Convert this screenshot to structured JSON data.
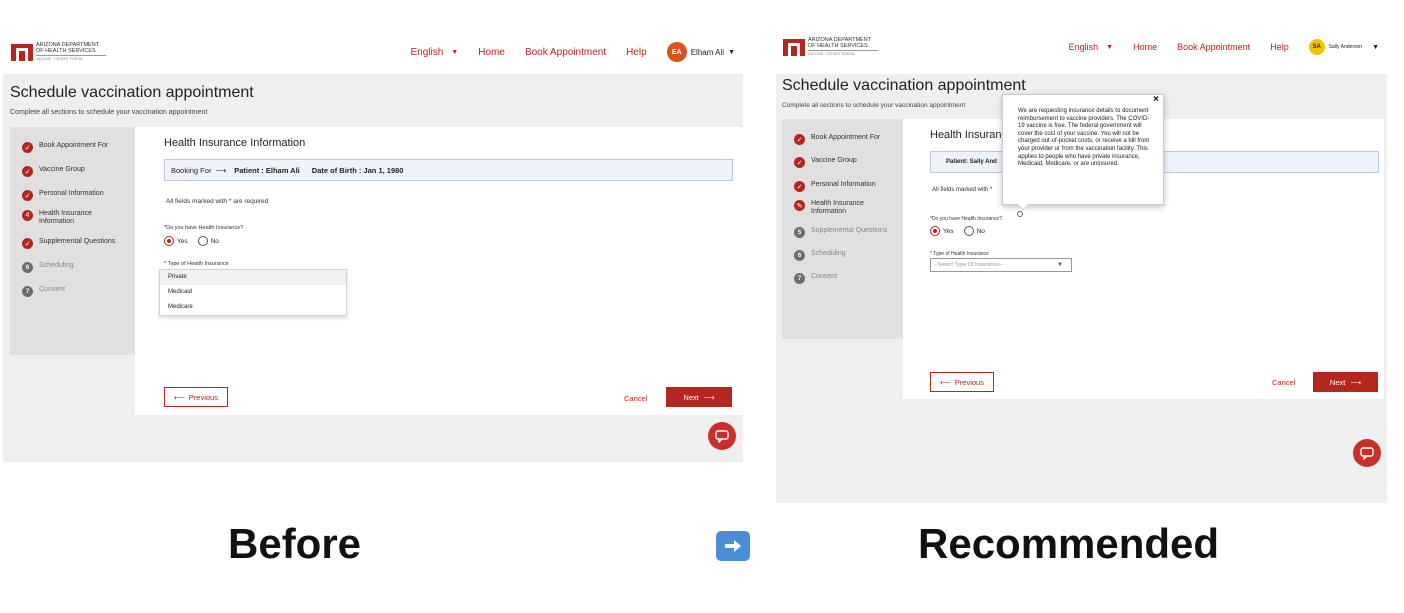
{
  "logo": {
    "line1": "ARIZONA DEPARTMENT",
    "line2": "OF HEALTH SERVICES",
    "line3": "VACCINE · PATIENT PORTAL"
  },
  "nav": {
    "language": "English",
    "home": "Home",
    "book": "Book Appointment",
    "help": "Help"
  },
  "page": {
    "title": "Schedule vaccination appointment",
    "subtitle": "Complete all sections to schedule your vaccination appointment"
  },
  "steps": [
    {
      "num": "1",
      "label": "Book Appointment For"
    },
    {
      "num": "2",
      "label": "Vaccine Group"
    },
    {
      "num": "3",
      "label": "Personal Information"
    },
    {
      "num": "4",
      "label": "Health Insurance Information"
    },
    {
      "num": "5",
      "label": "Supplemental Questions"
    },
    {
      "num": "6",
      "label": "Scheduling"
    },
    {
      "num": "7",
      "label": "Consent"
    }
  ],
  "form": {
    "section_title": "Health Insurance Information",
    "required_note": "All fields marked with * are required",
    "question": "*Do you have Health Insurance?",
    "yes": "Yes",
    "no": "No",
    "type_label": "* Type of Health Insurance",
    "select_placeholder": "--Select Type Of Insurance--",
    "previous": "Previous",
    "cancel": "Cancel",
    "next": "Next"
  },
  "before": {
    "user_initials": "EA",
    "user_name": "Elham Ali",
    "booking_for": "Booking For",
    "patient": "Patient : Elham Ali",
    "dob": "Date of Birth : Jan 1, 1980",
    "options": [
      "Private",
      "Medicaid",
      "Medicare"
    ]
  },
  "after": {
    "user_initials": "SA",
    "user_name": "Sally Anderson",
    "patient_partial": "Patient: Sally And",
    "section_title_partial": "Health Insuranc",
    "required_partial": "All fields marked with *",
    "tooltip": "We are requesting insurance details to document reimbursement to vaccine providers. The COVID-19 vaccine is free. The federal government will cover the cost of your vaccine. You will not be charged out-of-pocket costs, or receive a bill from your provider or from the vaccination facility. This applies to people who have private insurance, Medicaid, Medicare, or are uninsured."
  },
  "captions": {
    "before": "Before",
    "after": "Recommended"
  },
  "colors": {
    "brand": "#b5261e",
    "avatar_before": "#d9531e",
    "avatar_after": "#f2c200"
  }
}
